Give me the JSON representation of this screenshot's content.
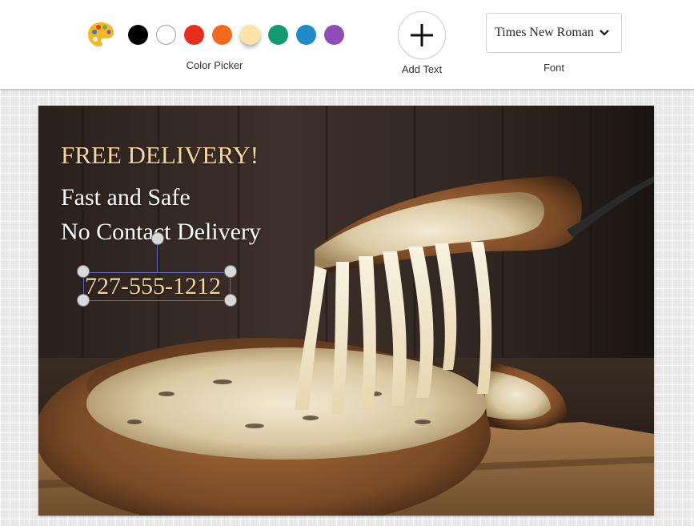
{
  "toolbar": {
    "palette_icon": "artist-palette-icon",
    "colors": [
      {
        "name": "black",
        "hex": "#000000"
      },
      {
        "name": "white",
        "hex": "#ffffff"
      },
      {
        "name": "red",
        "hex": "#e62e1a"
      },
      {
        "name": "orange",
        "hex": "#f46a1a"
      },
      {
        "name": "cream",
        "hex": "#fde4a6",
        "selected": true
      },
      {
        "name": "green",
        "hex": "#0f9a72"
      },
      {
        "name": "blue",
        "hex": "#1e8bc8"
      },
      {
        "name": "purple",
        "hex": "#8f4bb6"
      }
    ],
    "color_picker_label": "Color Picker",
    "add_text_label": "Add Text",
    "add_text_icon": "plus-icon",
    "font_select_value": "Times New Roman",
    "font_select_icon": "chevron-down-icon",
    "font_label": "Font"
  },
  "canvas": {
    "headline": "FREE DELIVERY!",
    "line1": "Fast and Safe",
    "line2": "No Contact Delivery",
    "phone": "727-555-1212",
    "colors": {
      "headline": "#f6d79b",
      "body_text": "#ffffff",
      "selection": "#5c6bc0"
    }
  }
}
